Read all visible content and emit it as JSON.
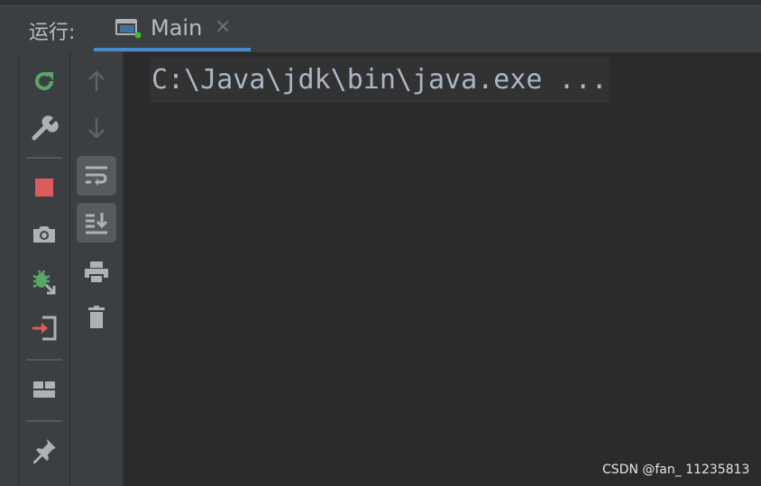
{
  "run_panel": {
    "label": "运行:",
    "tab": {
      "title": "Main",
      "close": "×"
    }
  },
  "toolbar_primary": [
    {
      "name": "rerun",
      "icon": "rerun-icon"
    },
    {
      "name": "modify-configuration",
      "icon": "wrench-icon"
    },
    {
      "name": "stop",
      "icon": "stop-icon"
    },
    {
      "name": "dump-threads",
      "icon": "camera-icon"
    },
    {
      "name": "attach-debugger",
      "icon": "bug-arrow-icon"
    },
    {
      "name": "exit",
      "icon": "exit-icon"
    },
    {
      "name": "restore-layout",
      "icon": "layout-icon"
    },
    {
      "name": "pin-tab",
      "icon": "pin-icon"
    }
  ],
  "toolbar_secondary": [
    {
      "name": "up-stack",
      "icon": "arrow-up-icon",
      "state": "disabled"
    },
    {
      "name": "down-stack",
      "icon": "arrow-down-icon",
      "state": "disabled"
    },
    {
      "name": "soft-wrap",
      "icon": "soft-wrap-icon",
      "state": "toggled"
    },
    {
      "name": "scroll-to-end",
      "icon": "scroll-end-icon",
      "state": "toggled"
    },
    {
      "name": "print",
      "icon": "print-icon"
    },
    {
      "name": "clear-all",
      "icon": "trash-icon"
    }
  ],
  "console": {
    "lines": [
      "C:\\Java\\jdk\\bin\\java.exe ..."
    ]
  },
  "watermark": "CSDN @fan_ 11235813",
  "colors": {
    "panel_bg": "#3c3f41",
    "console_bg": "#2b2b2b",
    "tab_underline": "#4a88c7",
    "rerun_green": "#59a869",
    "stop_red": "#db5c5c",
    "text": "#bbbbbb"
  }
}
